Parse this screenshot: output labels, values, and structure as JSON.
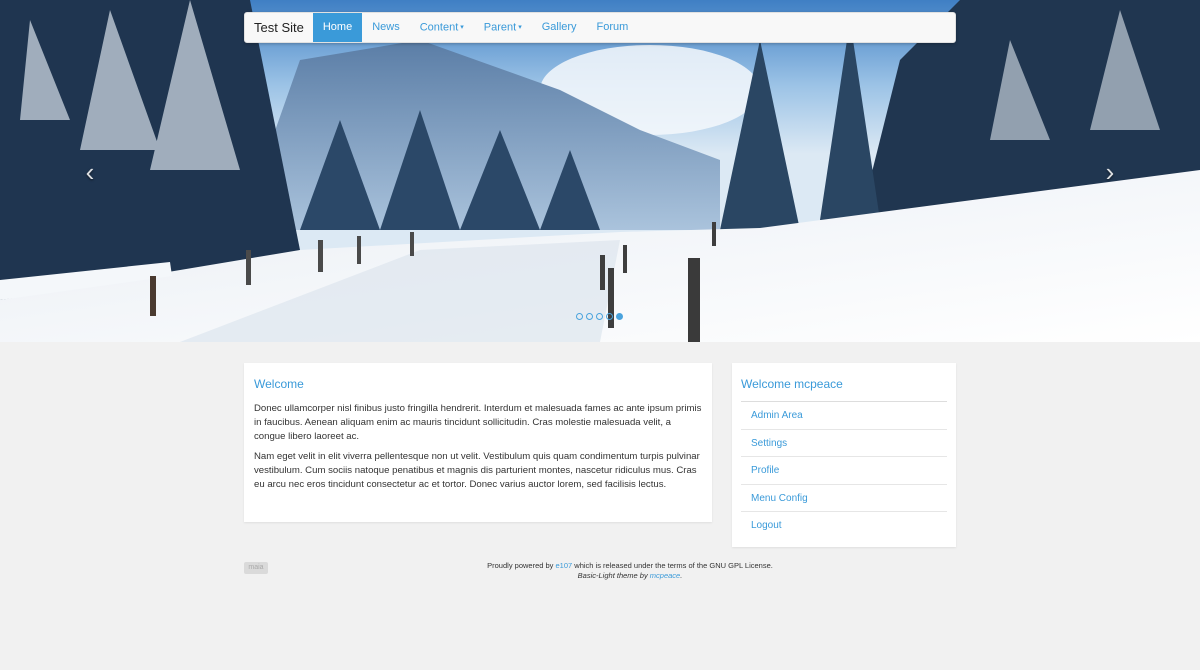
{
  "nav": {
    "brand": "Test Site",
    "items": [
      {
        "label": "Home",
        "active": true,
        "dropdown": false
      },
      {
        "label": "News",
        "active": false,
        "dropdown": false
      },
      {
        "label": "Content",
        "active": false,
        "dropdown": true
      },
      {
        "label": "Parent",
        "active": false,
        "dropdown": true
      },
      {
        "label": "Gallery",
        "active": false,
        "dropdown": false
      },
      {
        "label": "Forum",
        "active": false,
        "dropdown": false
      }
    ],
    "caret": "▾"
  },
  "carousel": {
    "prev_icon": "‹",
    "next_icon": "›",
    "slide_count": 5,
    "active_index": 4
  },
  "welcome": {
    "title": "Welcome",
    "paragraphs": [
      "Donec ullamcorper nisl finibus justo fringilla hendrerit. Interdum et malesuada fames ac ante ipsum primis in faucibus. Aenean aliquam enim ac mauris tincidunt sollicitudin. Cras molestie malesuada velit, a congue libero laoreet ac.",
      "Nam eget velit in elit viverra pellentesque non ut velit. Vestibulum quis quam condimentum turpis pulvinar vestibulum. Cum sociis natoque penatibus et magnis dis parturient montes, nascetur ridiculus mus. Cras eu arcu nec eros tincidunt consectetur ac et tortor. Donec varius auctor lorem, sed facilisis lectus."
    ]
  },
  "user_menu": {
    "title": "Welcome mcpeace",
    "items": [
      "Admin Area",
      "Settings",
      "Profile",
      "Menu Config",
      "Logout"
    ]
  },
  "footer": {
    "badge": "maia",
    "powered_prefix": "Proudly powered by ",
    "powered_link": "e107",
    "powered_suffix": " which is released under the terms of the GNU GPL License.",
    "theme_prefix": "Basic-Light theme by ",
    "theme_link": "mcpeace",
    "theme_suffix": "."
  },
  "colors": {
    "accent": "#3a9ad9",
    "background": "#f1f1f1"
  }
}
